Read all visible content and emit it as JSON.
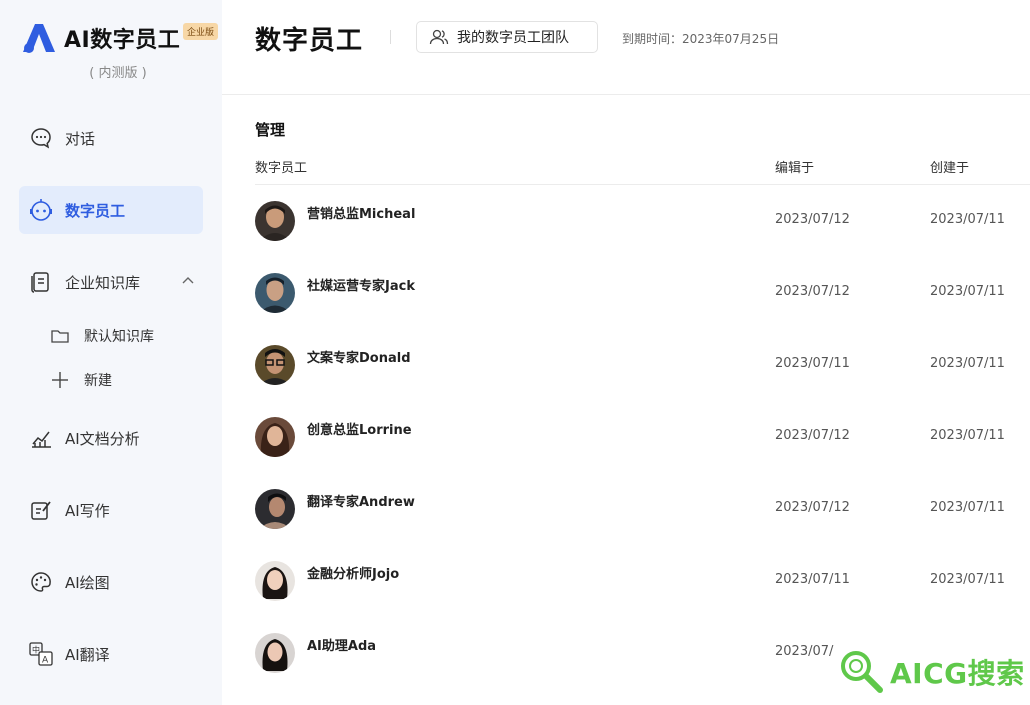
{
  "brand": {
    "name": "AI数字员工",
    "badge": "企业版",
    "beta": "( 内测版 )",
    "accent": "#2f5de0"
  },
  "sidebar": {
    "items": [
      {
        "label": "对话",
        "icon": "chat-icon"
      },
      {
        "label": "数字员工",
        "icon": "robot-icon",
        "active": true
      },
      {
        "label": "企业知识库",
        "icon": "document-icon",
        "expanded": true
      },
      {
        "label": "AI文档分析",
        "icon": "chart-icon"
      },
      {
        "label": "AI写作",
        "icon": "edit-icon"
      },
      {
        "label": "AI绘图",
        "icon": "palette-icon"
      },
      {
        "label": "AI翻译",
        "icon": "translate-icon"
      }
    ],
    "sub_items": [
      {
        "label": "默认知识库",
        "icon": "folder-icon"
      },
      {
        "label": "新建",
        "icon": "plus-icon"
      }
    ]
  },
  "header": {
    "title": "数字员工",
    "team_button": "我的数字员工团队",
    "expiry": "到期时间：2023年07月25日"
  },
  "main": {
    "section_title": "管理",
    "columns": [
      "数字员工",
      "编辑于",
      "创建于"
    ],
    "rows": [
      {
        "name": "营销总监Micheal",
        "edited": "2023/07/12",
        "created": "2023/07/11",
        "avatar": "avatar-man-1"
      },
      {
        "name": "社媒运营专家Jack",
        "edited": "2023/07/12",
        "created": "2023/07/11",
        "avatar": "avatar-man-2"
      },
      {
        "name": "文案专家Donald",
        "edited": "2023/07/11",
        "created": "2023/07/11",
        "avatar": "avatar-man-glasses"
      },
      {
        "name": "创意总监Lorrine",
        "edited": "2023/07/12",
        "created": "2023/07/11",
        "avatar": "avatar-woman-1"
      },
      {
        "name": "翻译专家Andrew",
        "edited": "2023/07/12",
        "created": "2023/07/11",
        "avatar": "avatar-man-3"
      },
      {
        "name": "金融分析师Jojo",
        "edited": "2023/07/11",
        "created": "2023/07/11",
        "avatar": "avatar-woman-2"
      },
      {
        "name": "AI助理Ada",
        "edited": "2023/07/",
        "created": "",
        "avatar": "avatar-woman-3"
      }
    ]
  },
  "watermark": {
    "text": "AICG搜索",
    "color": "#5fc84a"
  }
}
